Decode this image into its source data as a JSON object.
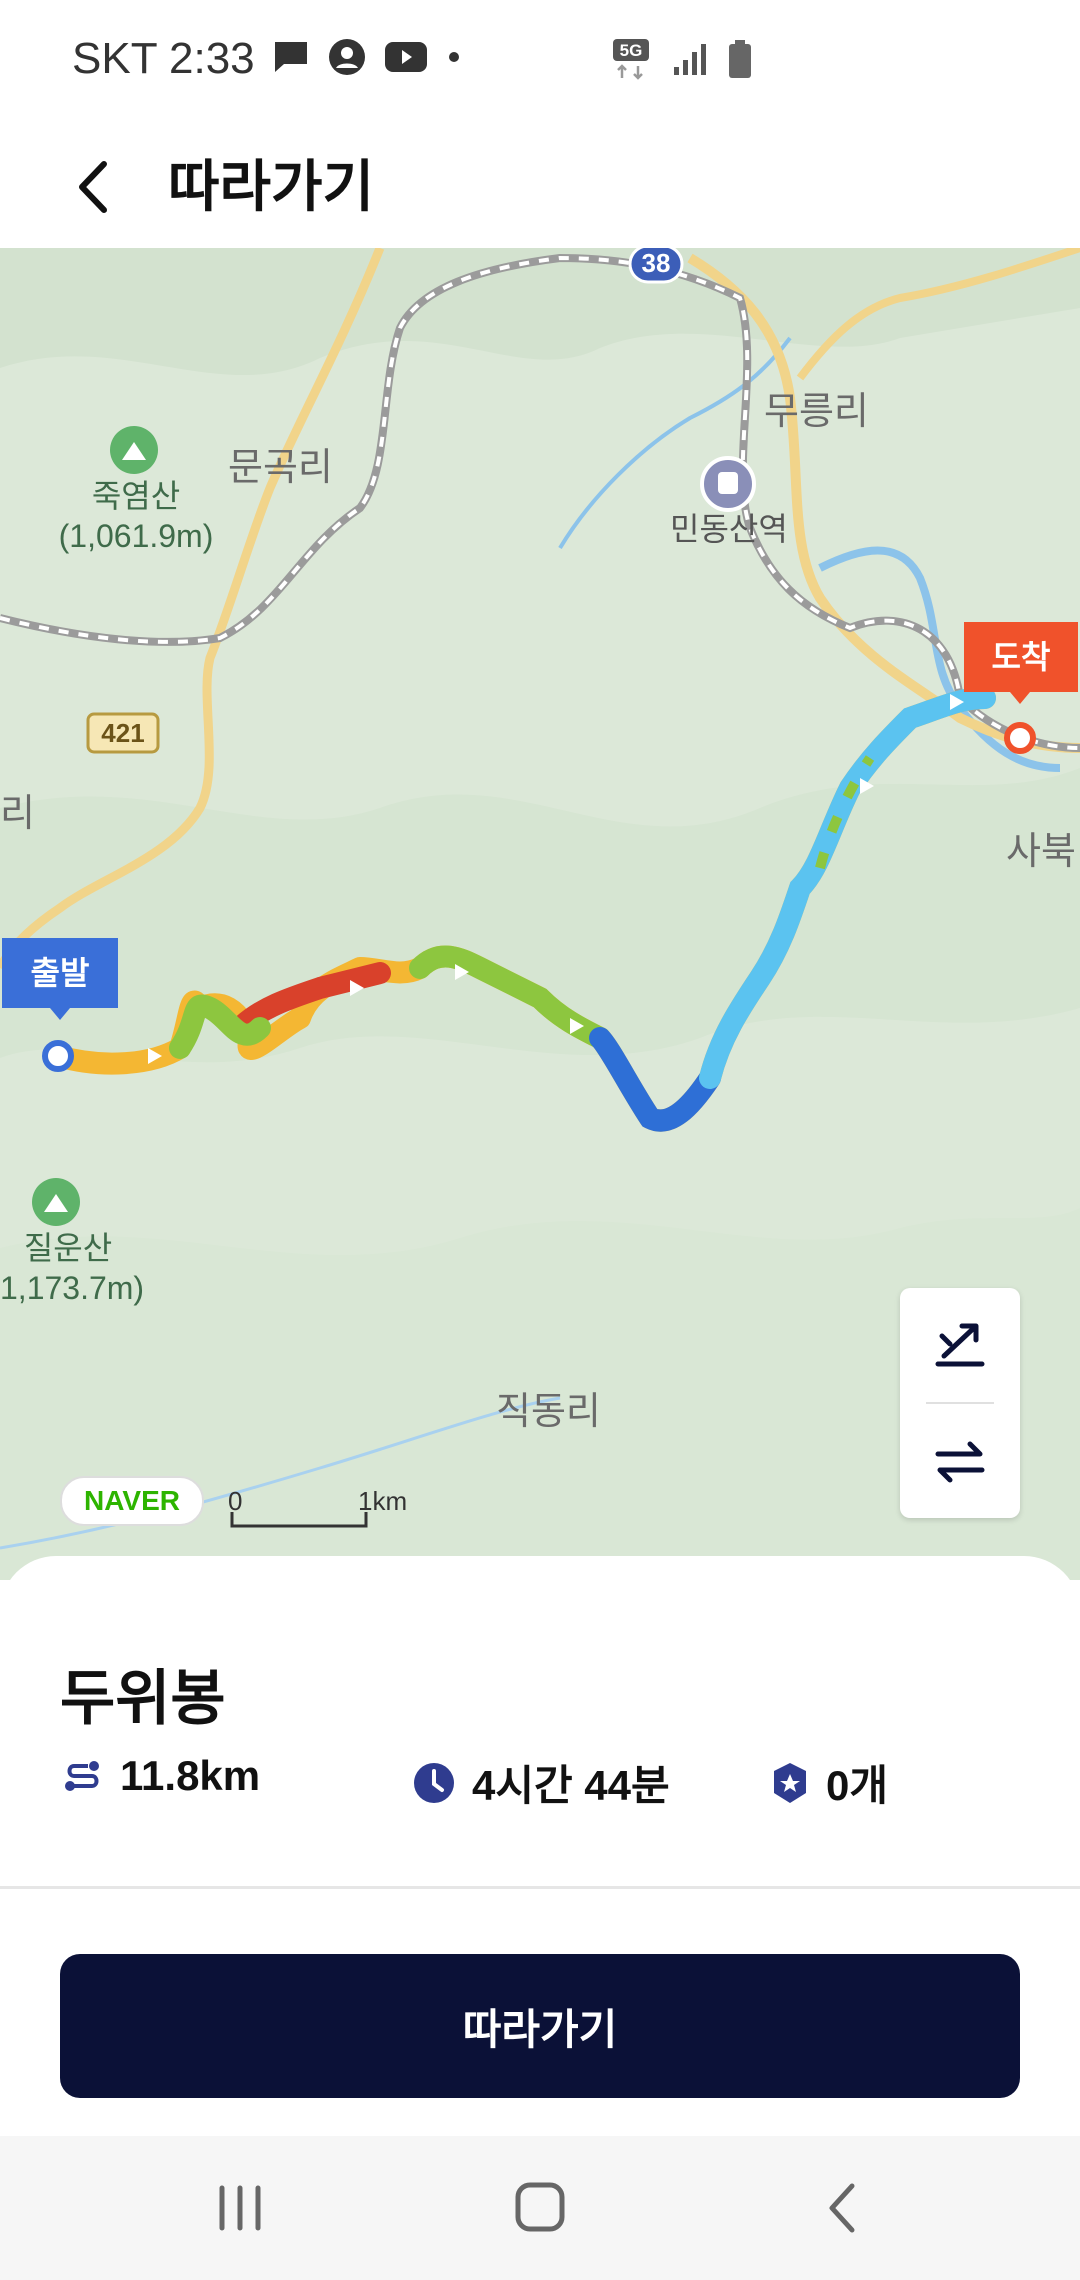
{
  "status_bar": {
    "carrier_time": "SKT 2:33",
    "network": "5G",
    "icons": [
      "message-icon",
      "account-icon",
      "youtube-icon",
      "dot-icon",
      "5g-icon",
      "signal-icon",
      "battery-icon"
    ]
  },
  "app_bar": {
    "back_icon": "chevron-left-icon",
    "title": "따라가기"
  },
  "map": {
    "places": {
      "munkok": "문곡리",
      "mureung": "무릉리",
      "mindong": "민동산역",
      "sabuk": "사북",
      "jikdong": "직동리",
      "edge_ri": "리"
    },
    "peaks": {
      "jukyeom": "죽염산\n(1,061.9m)",
      "jilun": "질운산\n1,173.7m)"
    },
    "roads": {
      "r38": "38",
      "r421": "421"
    },
    "start_label": "출발",
    "end_label": "도착",
    "naver_logo": "NAVER",
    "scale_zero": "0",
    "scale_one": "1km",
    "controls": [
      "elevation-toggle-icon",
      "reverse-route-icon"
    ],
    "colors": {
      "start": "#3a6fd8",
      "end": "#f0522b",
      "route_yellow": "#f4b733",
      "route_red": "#d9412b",
      "route_green": "#8dc63f",
      "route_blue": "#2e6fd6",
      "route_sky": "#5bc3f0"
    }
  },
  "trail": {
    "name": "두위봉",
    "distance": "11.8km",
    "duration": "4시간 44분",
    "stamps": "0개",
    "icons": [
      "route-distance-icon",
      "clock-icon",
      "stamp-badge-icon"
    ]
  },
  "actions": {
    "follow_label": "따라가기"
  },
  "system_nav": {
    "icons": [
      "recent-apps-icon",
      "home-icon",
      "back-icon"
    ]
  }
}
